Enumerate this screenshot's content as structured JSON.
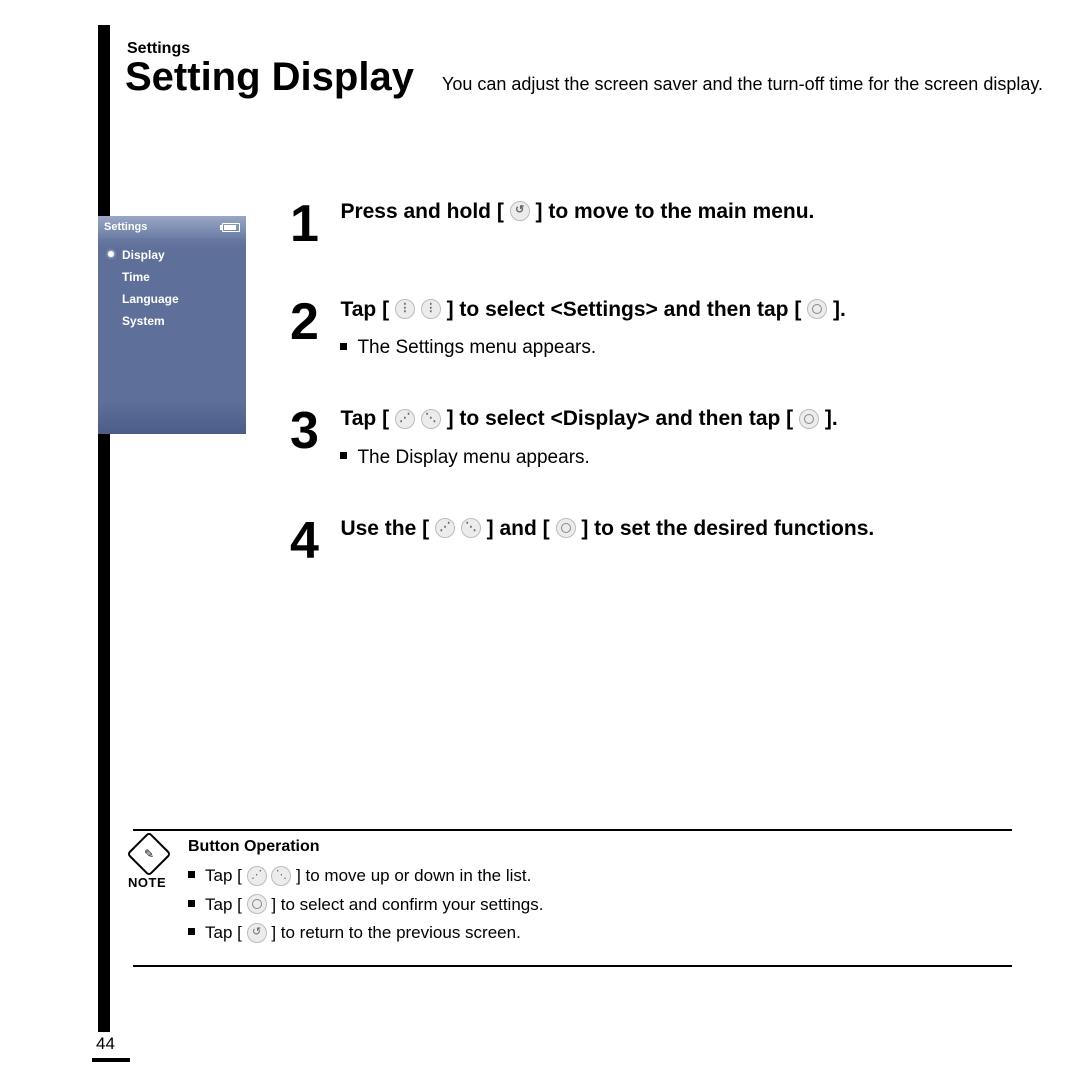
{
  "header": {
    "breadcrumb": "Settings",
    "title": "Setting Display",
    "description": "You can adjust the screen saver and the turn-off time for the screen display."
  },
  "phone": {
    "title": "Settings",
    "items": [
      "Display",
      "Time",
      "Language",
      "System"
    ],
    "selectedIndex": 0
  },
  "steps": [
    {
      "num": "1",
      "head_a": "Press and hold [",
      "icon": "back",
      "head_b": "] to move to the main menu."
    },
    {
      "num": "2",
      "head_a": "Tap [",
      "icon": "lr",
      "head_b": "] to select <Settings> and then tap [",
      "icon2": "round",
      "head_c": "].",
      "sub": "The Settings menu appears."
    },
    {
      "num": "3",
      "head_a": "Tap [",
      "icon": "ud",
      "head_b": "] to select <Display> and then tap [",
      "icon2": "round",
      "head_c": "].",
      "sub": "The Display menu appears."
    },
    {
      "num": "4",
      "head_a": "Use the [",
      "icon": "ud",
      "head_b": "] and [",
      "icon2": "round",
      "head_c": "] to set the desired functions."
    }
  ],
  "note": {
    "label": "NOTE",
    "title": "Button Operation",
    "items": [
      {
        "a": "Tap [",
        "icon": "ud",
        "b": "] to move up or down in the list."
      },
      {
        "a": "Tap [",
        "icon": "round",
        "b": "] to select and confirm your settings."
      },
      {
        "a": "Tap [",
        "icon": "back",
        "b": "] to return to the previous screen."
      }
    ]
  },
  "pageNumber": "44",
  "iconGlyph": {
    "back": "↺",
    "lr_l": "⋮",
    "lr_r": "⋮",
    "ud_u": "⋰",
    "ud_d": "⋱"
  }
}
